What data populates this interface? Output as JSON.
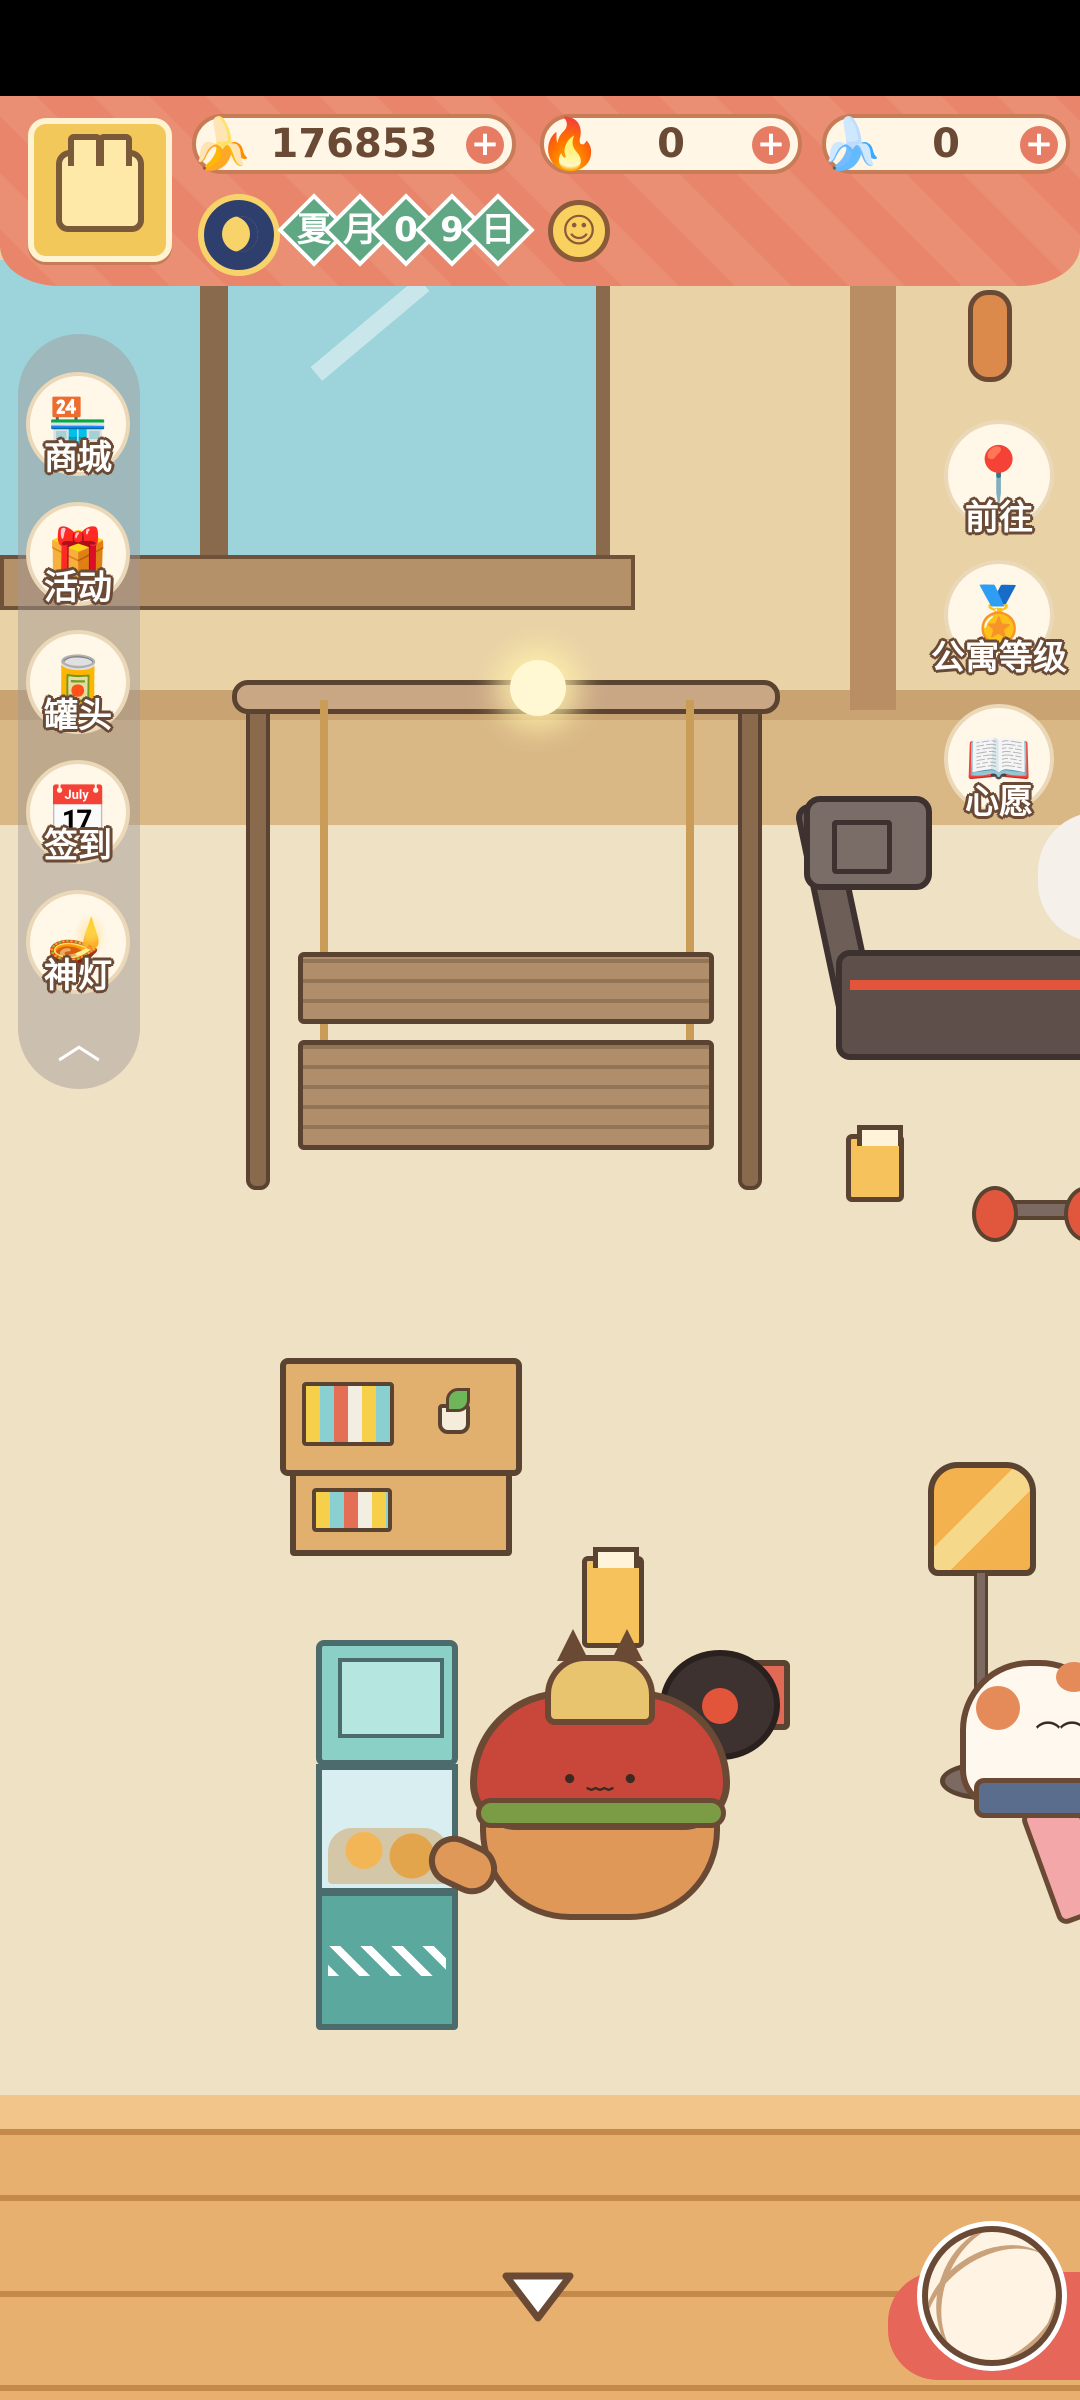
{
  "hud": {
    "bananas": {
      "value": "176853",
      "icon": "banana-icon"
    },
    "blue_flame": {
      "value": "0",
      "icon": "blue-flame-icon"
    },
    "blue_banana": {
      "value": "0",
      "icon": "blue-banana-icon"
    },
    "date_chars": [
      "夏",
      "月",
      "0",
      "9",
      "日"
    ],
    "weather_icon": "sun-icon"
  },
  "left_menu": {
    "items": [
      {
        "label": "商城",
        "icon": "shop-icon"
      },
      {
        "label": "活动",
        "icon": "gift-icon"
      },
      {
        "label": "罐头",
        "icon": "can-icon"
      },
      {
        "label": "签到",
        "icon": "checkin-icon"
      },
      {
        "label": "神灯",
        "icon": "magic-lamp-icon"
      }
    ],
    "collapse_icon": "chevron-up-icon"
  },
  "right_menu": {
    "items": [
      {
        "label": "前往",
        "icon": "map-pin-icon"
      },
      {
        "label": "公寓等级",
        "icon": "apartment-level-icon"
      },
      {
        "label": "心愿",
        "icon": "wish-book-icon"
      }
    ]
  },
  "colors": {
    "hud_band": "#e8856b",
    "date_chip": "#5fa883",
    "plus_button": "#e77c64",
    "outline": "#6b4a35"
  }
}
